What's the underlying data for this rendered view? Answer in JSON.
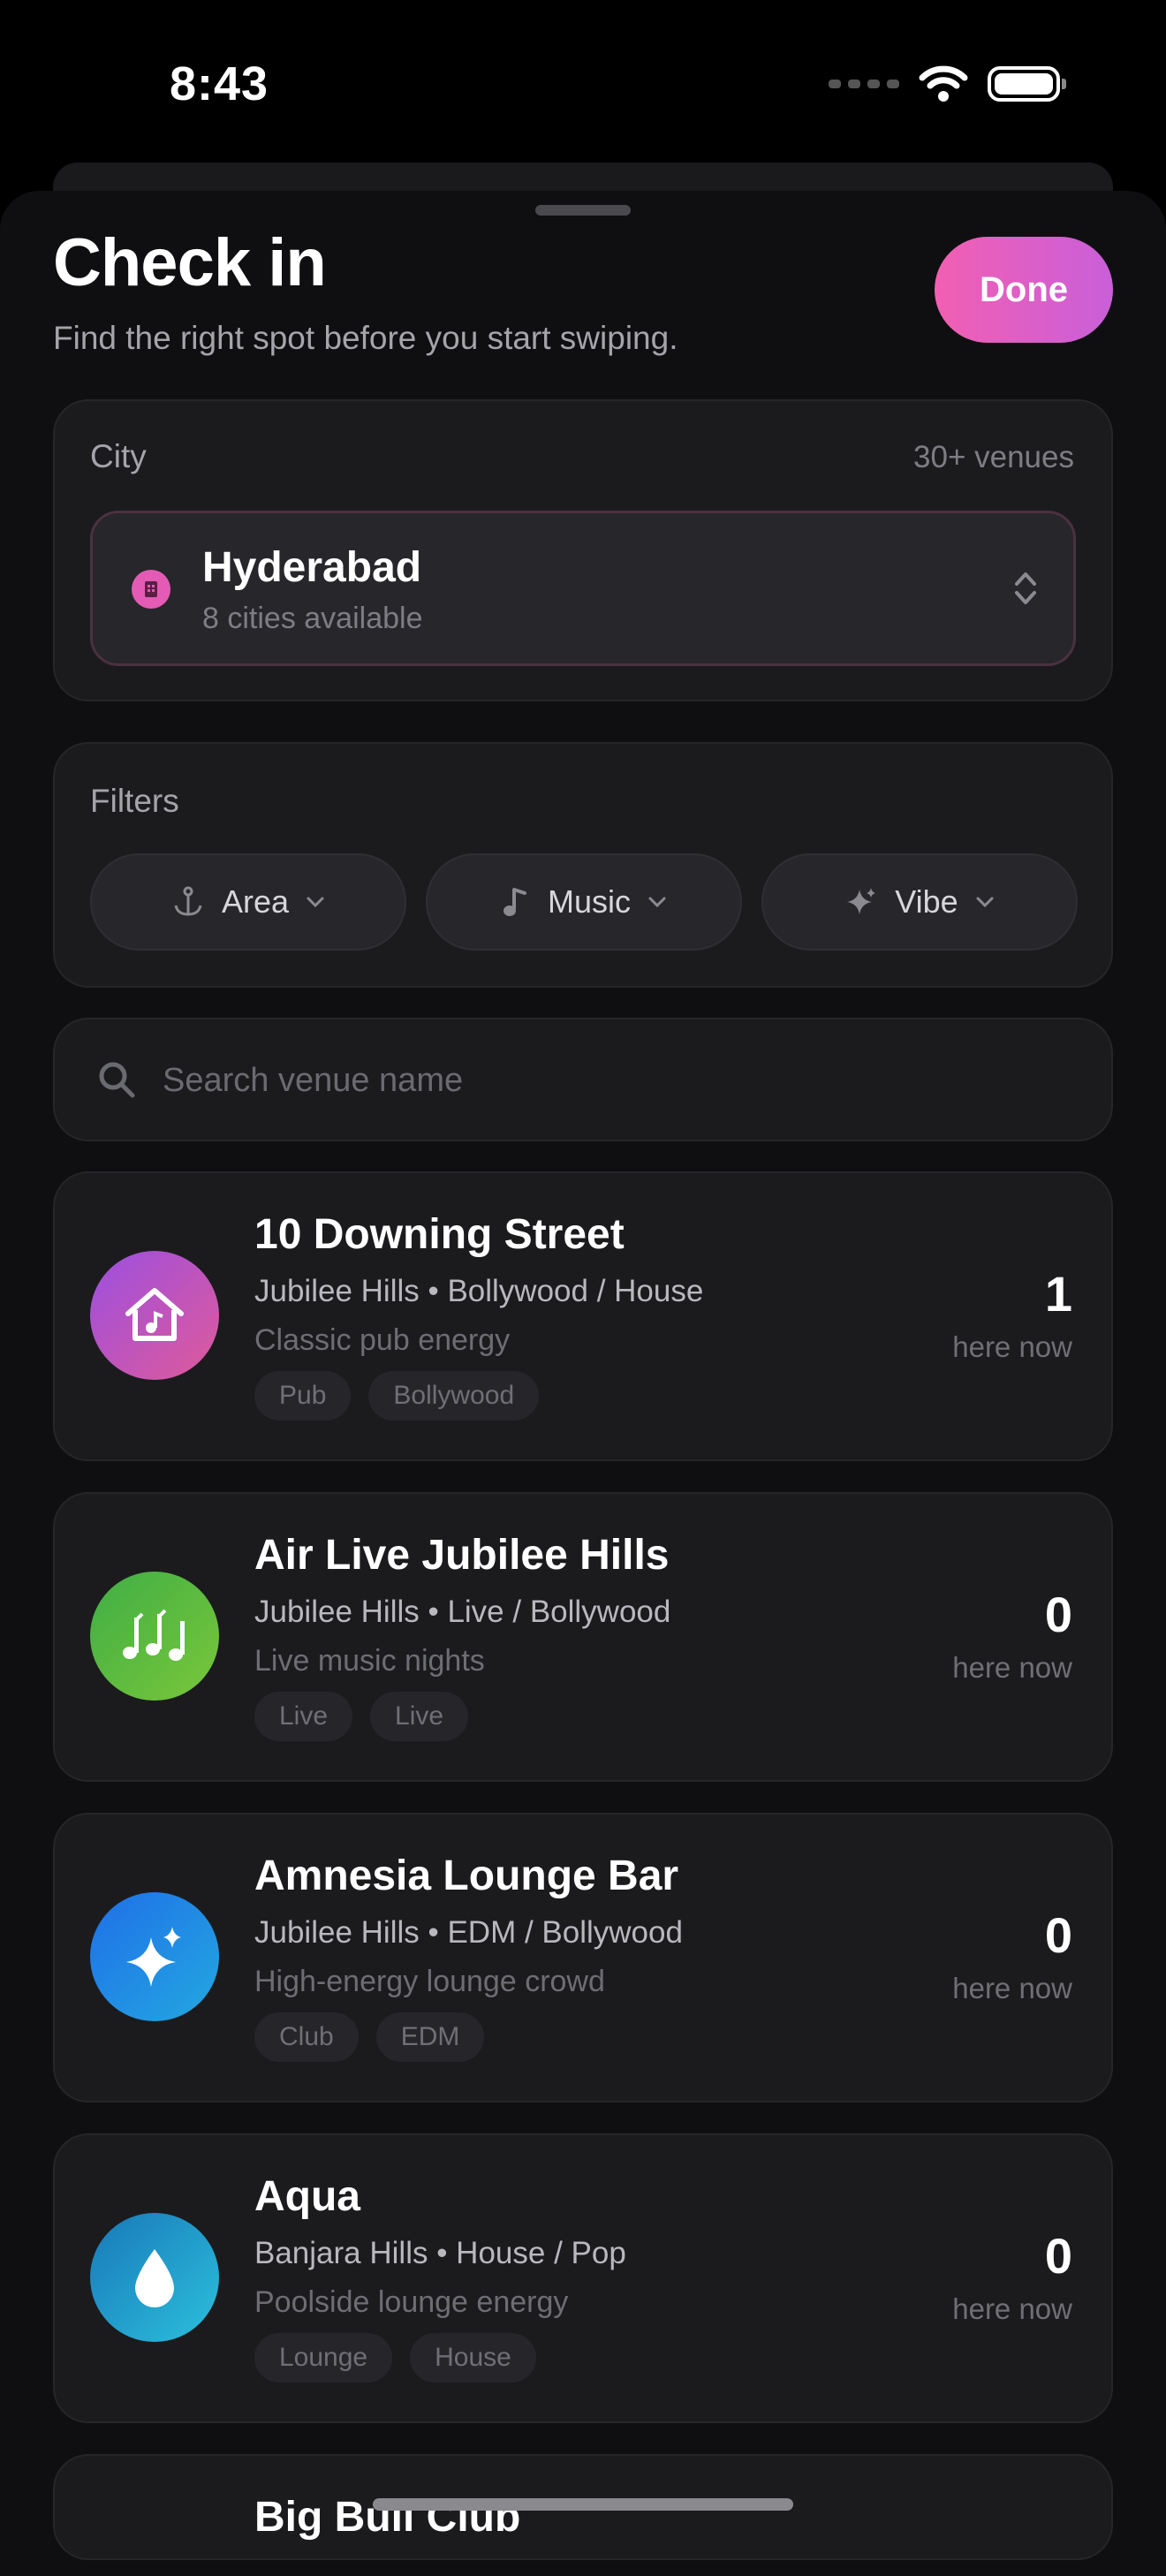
{
  "status_bar": {
    "time": "8:43"
  },
  "header": {
    "title": "Check in",
    "subtitle": "Find the right spot before you start swiping.",
    "done_label": "Done"
  },
  "city": {
    "label": "City",
    "venue_count": "30+ venues",
    "selected": "Hyderabad",
    "available": "8 cities available"
  },
  "filters": {
    "label": "Filters",
    "chips": [
      {
        "label": "Area",
        "icon": "anchor-icon"
      },
      {
        "label": "Music",
        "icon": "music-note-icon"
      },
      {
        "label": "Vibe",
        "icon": "sparkle-icon"
      }
    ]
  },
  "search": {
    "placeholder": "Search venue name"
  },
  "venues": [
    {
      "name": "10 Downing Street",
      "meta": "Jubilee Hills • Bollywood / House",
      "desc": "Classic pub energy",
      "tags": [
        "Pub",
        "Bollywood"
      ],
      "count": "1",
      "here": "here now",
      "icon": "house-music-icon",
      "color": "#b152d6"
    },
    {
      "name": "Air Live Jubilee Hills",
      "meta": "Jubilee Hills • Live / Bollywood",
      "desc": "Live music nights",
      "tags": [
        "Live",
        "Live"
      ],
      "count": "0",
      "here": "here now",
      "icon": "music-notes-icon",
      "color": "#4cb84a"
    },
    {
      "name": "Amnesia Lounge Bar",
      "meta": "Jubilee Hills • EDM / Bollywood",
      "desc": "High-energy lounge crowd",
      "tags": [
        "Club",
        "EDM"
      ],
      "count": "0",
      "here": "here now",
      "icon": "sparkles-icon",
      "color": "#1f7ae6"
    },
    {
      "name": "Aqua",
      "meta": "Banjara Hills • House / Pop",
      "desc": "Poolside lounge energy",
      "tags": [
        "Lounge",
        "House"
      ],
      "count": "0",
      "here": "here now",
      "icon": "water-drop-icon",
      "color": "#1c96c7"
    },
    {
      "name": "Big Bull Club"
    }
  ]
}
